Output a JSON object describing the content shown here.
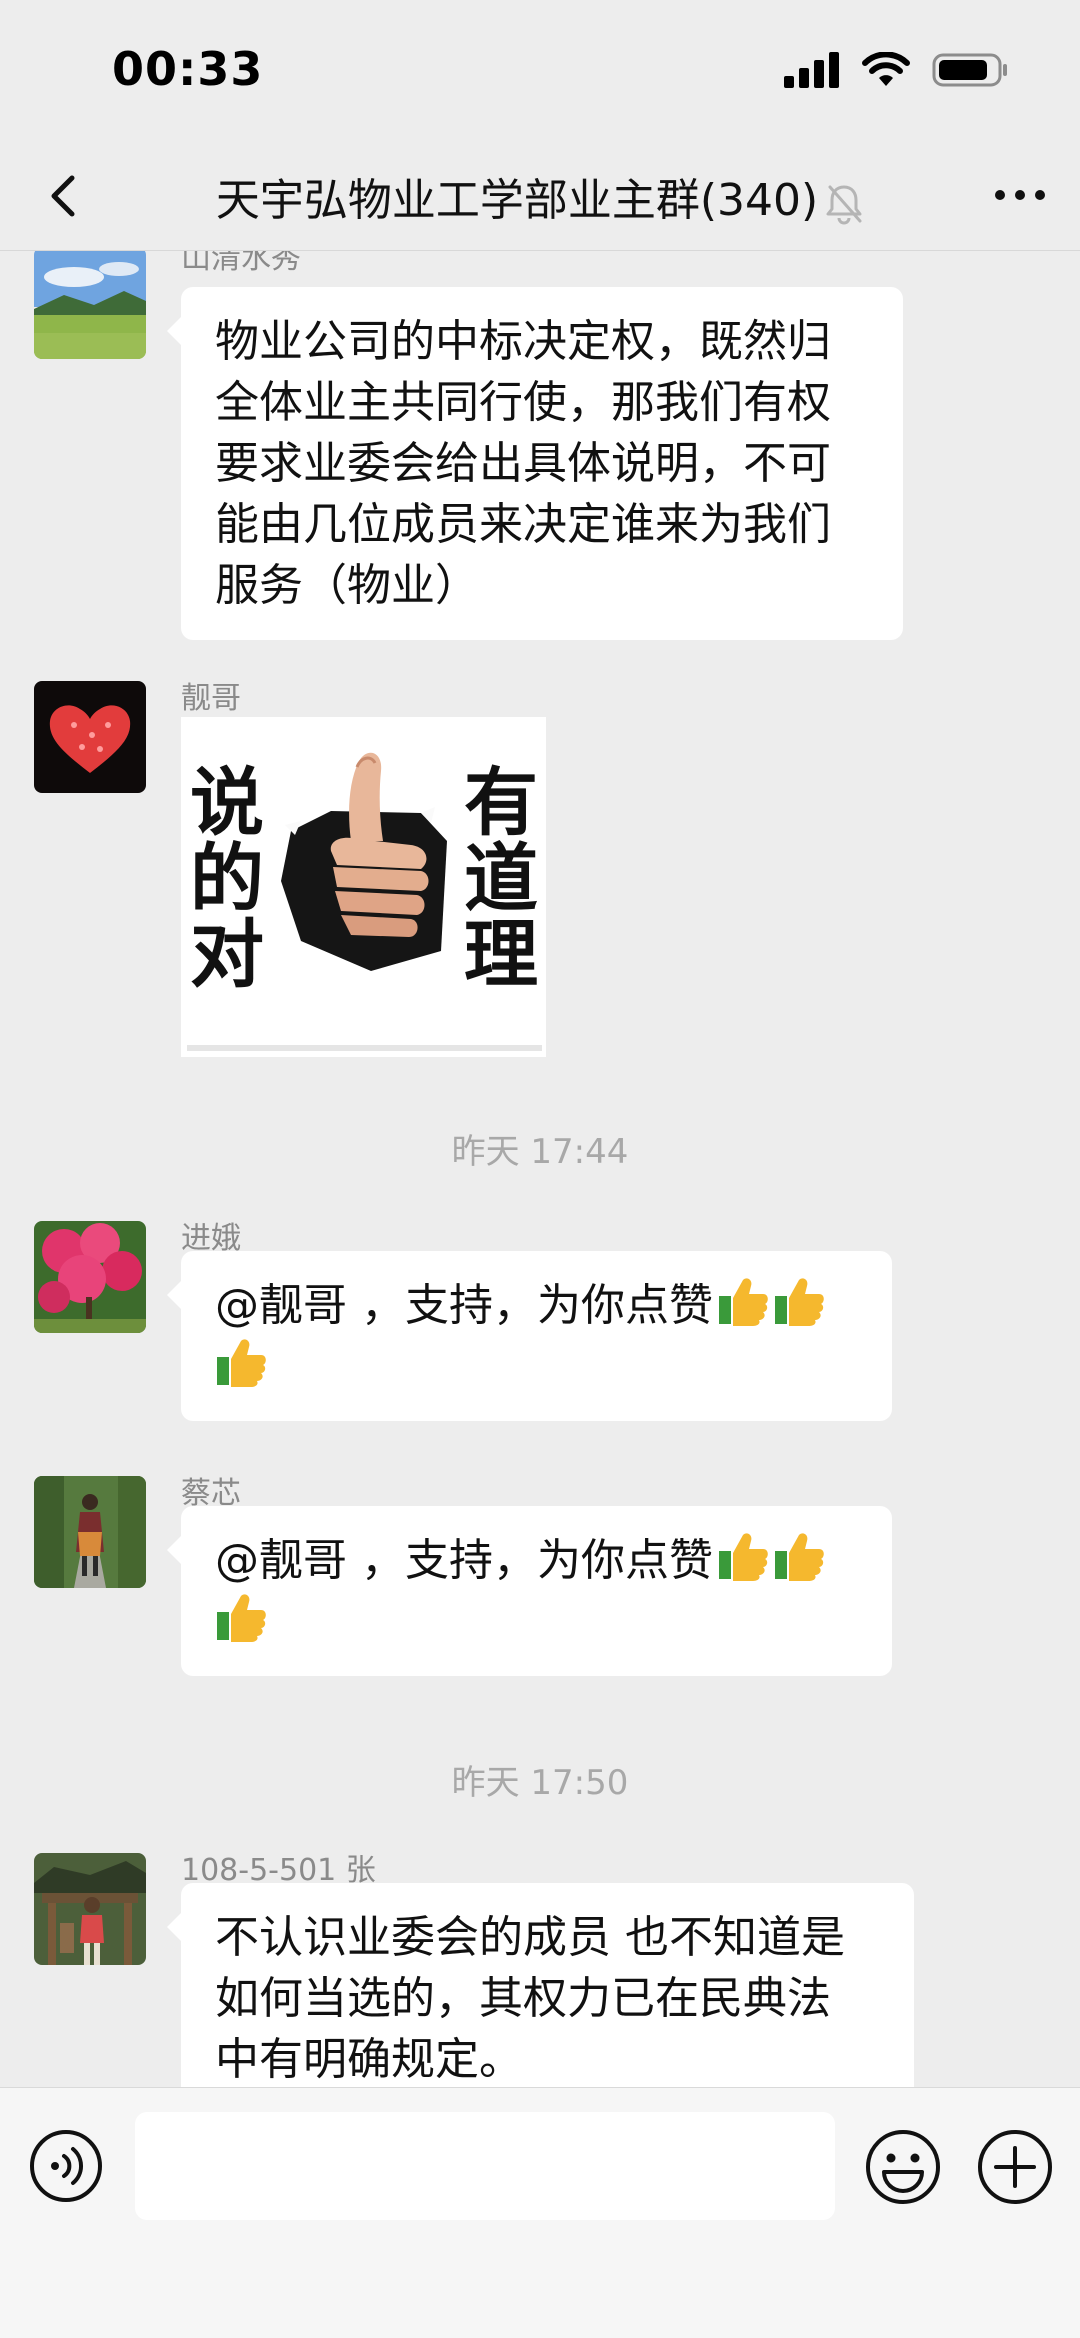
{
  "status_bar": {
    "time": "00:33"
  },
  "header": {
    "title": "天宇弘物业工学部业主群(340)",
    "back_icon": "chevron-left-icon",
    "mute_icon": "bell-off-icon",
    "more_icon": "ellipsis-icon"
  },
  "messages": [
    {
      "sender": "山清水秀",
      "lines": [
        "物业公司的中标决定权，既然归",
        "全体业主共同行使，那我们有权",
        "要求业委会给出具体说明，不可",
        "能由几位成员来决定谁来为我们",
        "服务（物业）"
      ]
    },
    {
      "sender": "靓哥",
      "sticker": {
        "left_text": [
          "说",
          "的",
          "对"
        ],
        "right_text": [
          "有",
          "道",
          "理"
        ]
      }
    },
    {
      "timestamp": "昨天 17:44"
    },
    {
      "sender": "进娥",
      "text": "@靓哥 ，支持，为你点赞"
    },
    {
      "sender": "蔡芯",
      "text": "@靓哥 ，支持，为你点赞"
    },
    {
      "timestamp": "昨天 17:50"
    },
    {
      "sender": "108-5-501 张",
      "lines": [
        "不认识业委会的成员 也不知道是",
        "如何当选的，其权力已在民典法",
        "中有明确规定。"
      ]
    }
  ],
  "input_bar": {
    "value": "",
    "voice_icon": "voice-icon",
    "emoji_icon": "emoji-icon",
    "plus_icon": "plus-icon"
  }
}
